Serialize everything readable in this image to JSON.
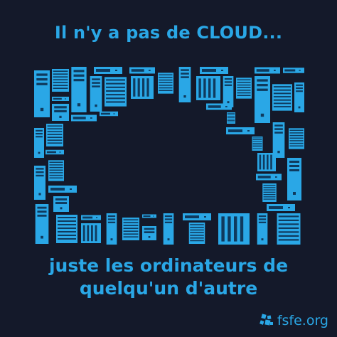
{
  "headline": "Il n'y a pas de CLOUD...",
  "tagline": {
    "line1": "juste les ordinateurs de",
    "line2": "quelqu'un d'autre"
  },
  "logo": {
    "text": "fsfe.org",
    "icon": "fsfe-logo-icon"
  },
  "colors": {
    "background": "#14192a",
    "accent": "#2aa7e6",
    "server_detail": "#0f3a5e"
  }
}
